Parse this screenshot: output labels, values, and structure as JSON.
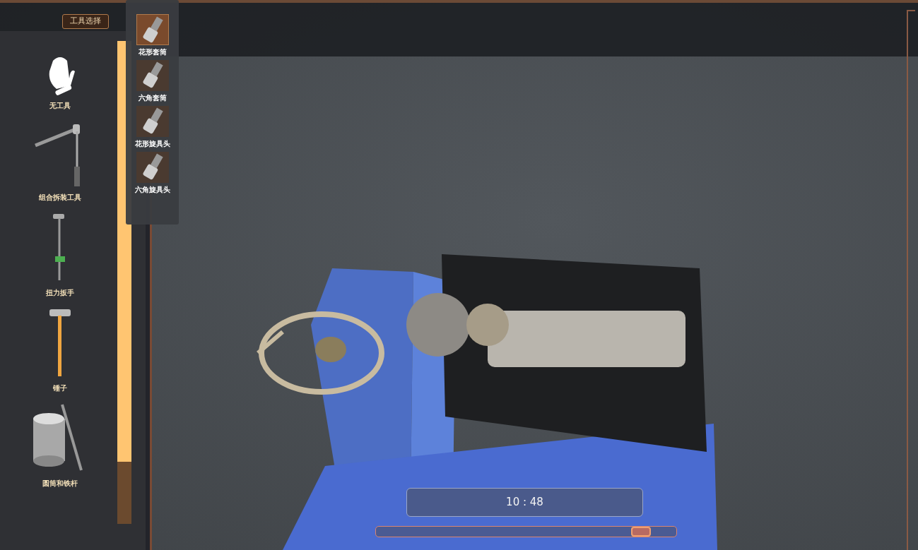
{
  "tab": {
    "label": "工具选择"
  },
  "tools": [
    {
      "label": "无工具",
      "kind": "glove"
    },
    {
      "label": "组合拆装工具",
      "kind": "ratchet"
    },
    {
      "label": "扭力扳手",
      "kind": "torque"
    },
    {
      "label": "锤子",
      "kind": "hammer"
    },
    {
      "label": "圆筒和铁杆",
      "kind": "cylinder"
    }
  ],
  "sockets": [
    {
      "label": "花形套筒",
      "selected": true
    },
    {
      "label": "六角套筒",
      "selected": false
    },
    {
      "label": "花形旋具头",
      "selected": false
    },
    {
      "label": "六角旋具头",
      "selected": false
    }
  ],
  "timer": {
    "text": "10 : 48"
  },
  "progress": {
    "level": 0.91
  }
}
